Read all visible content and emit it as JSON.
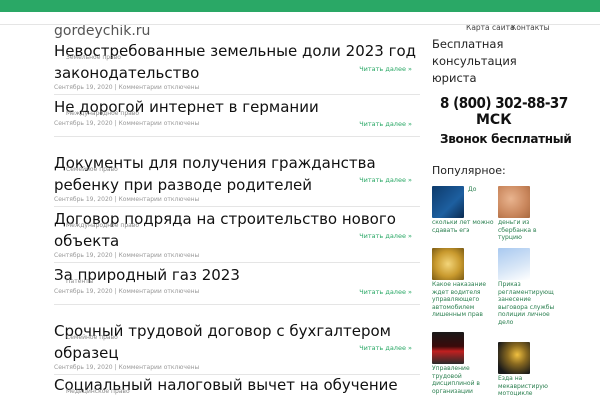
{
  "header": {
    "site_name": "gordeychik.ru",
    "nav": [
      "Карта сайта",
      "Контакты"
    ]
  },
  "posts": [
    {
      "title": "Невостребованные земельные доли 2023 год законодательство",
      "category": "Земельное право",
      "date": "Сентябрь 19, 2020",
      "comments": "Комментарии отключены",
      "read_more": "Читать далее »"
    },
    {
      "title": "Не дорогой интернет в германии",
      "category": "Международное право",
      "date": "Сентябрь 19, 2020",
      "comments": "Комментарии отключены",
      "read_more": "Читать далее »"
    },
    {
      "title": "Документы для получения гражданства ребенку при разводе родителей",
      "category": "Семейное право",
      "date": "Сентябрь 19, 2020",
      "comments": "Комментарии отключены",
      "read_more": "Читать далее »"
    },
    {
      "title": "Договор подряда на строительство нового объекта",
      "category": "Международное право",
      "date": "Сентябрь 19, 2020",
      "comments": "Комментарии отключены",
      "read_more": "Читать далее »"
    },
    {
      "title": "За природный газ 2023",
      "category": "Патенты",
      "date": "Сентябрь 19, 2020",
      "comments": "Комментарии отключены",
      "read_more": "Читать далее »"
    },
    {
      "title": "Срочный трудовой договор с бухгалтером образец",
      "category": "Семейное право",
      "date": "Сентябрь 19, 2020",
      "comments": "Комментарии отключены",
      "read_more": "Читать далее »"
    },
    {
      "title": "Социальный налоговый вычет на обучение",
      "category": "Медицинское право",
      "date": "",
      "comments": "",
      "read_more": ""
    }
  ],
  "sidebar": {
    "consult": "Бесплатная консультация юриста",
    "phone": "8 (800) 302-88-37",
    "city": "МСК",
    "call_free": "Звонок бесплатный",
    "popular_title": "Популярное:",
    "popular": [
      {
        "text": "скольки лет можно сдавать егэ",
        "side": "До",
        "icon": "thumb-image"
      },
      {
        "text": "деньги из сбербанка в турцию",
        "side": "",
        "icon": "thumb-image"
      },
      {
        "text": "Какое наказание ждет водителя управляющего автомобилем лишенным прав",
        "side": "",
        "icon": "thumb-image"
      },
      {
        "text": "Приказ регламентирующ занесение выговора службы полиции личное дело",
        "side": "",
        "icon": "thumb-image"
      },
      {
        "text": "Управление трудовой дисциплиной в организации",
        "side": "",
        "icon": "thumb-image"
      },
      {
        "text": "Езда на мекавристирую мотоцикле",
        "side": "",
        "icon": "thumb-image"
      }
    ]
  },
  "colors": {
    "accent": "#2aa866",
    "link": "#2a7f4f"
  }
}
